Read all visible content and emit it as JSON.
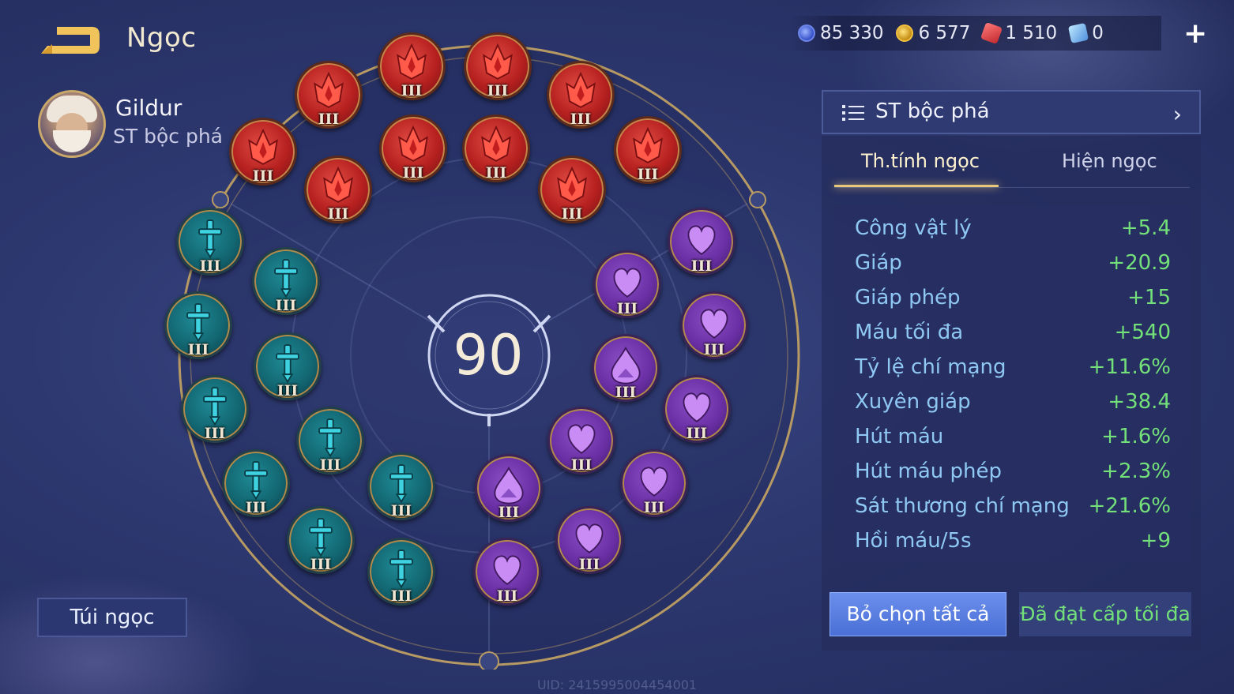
{
  "header": {
    "title": "Ngọc",
    "currencies": [
      {
        "icon": "blue-coin-icon",
        "value": "85 330"
      },
      {
        "icon": "gold-coin-icon",
        "value": "6 577"
      },
      {
        "icon": "red-gem-icon",
        "value": "1 510"
      },
      {
        "icon": "voucher-icon",
        "value": "0"
      }
    ],
    "plus_label": "+"
  },
  "hero": {
    "name": "Gildur",
    "preset": "ST bộc phá"
  },
  "ring": {
    "level": "90",
    "gems": [
      {
        "color": "red",
        "icon": "red-flame-gem-icon",
        "tier": "III"
      },
      {
        "color": "red",
        "icon": "red-flame-gem-icon",
        "tier": "III"
      },
      {
        "color": "red",
        "icon": "red-flame-gem-icon",
        "tier": "III"
      },
      {
        "color": "red",
        "icon": "red-flame-gem-icon",
        "tier": "III"
      },
      {
        "color": "red",
        "icon": "red-flame-gem-icon",
        "tier": "III"
      },
      {
        "color": "red",
        "icon": "red-flame-gem-icon",
        "tier": "III"
      },
      {
        "color": "red",
        "icon": "red-flame-gem-icon",
        "tier": "III"
      },
      {
        "color": "red",
        "icon": "red-flame-gem-icon",
        "tier": "III"
      },
      {
        "color": "red",
        "icon": "red-flame-gem-icon",
        "tier": "III"
      },
      {
        "color": "red",
        "icon": "red-flame-gem-icon",
        "tier": "III"
      },
      {
        "color": "teal",
        "icon": "teal-sword-gem-icon",
        "tier": "III"
      },
      {
        "color": "teal",
        "icon": "teal-sword-gem-icon",
        "tier": "III"
      },
      {
        "color": "teal",
        "icon": "teal-sword-gem-icon",
        "tier": "III"
      },
      {
        "color": "teal",
        "icon": "teal-sword-gem-icon",
        "tier": "III"
      },
      {
        "color": "teal",
        "icon": "teal-sword-gem-icon",
        "tier": "III"
      },
      {
        "color": "teal",
        "icon": "teal-sword-gem-icon",
        "tier": "III"
      },
      {
        "color": "teal",
        "icon": "teal-sword-gem-icon",
        "tier": "III"
      },
      {
        "color": "teal",
        "icon": "teal-sword-gem-icon",
        "tier": "III"
      },
      {
        "color": "teal",
        "icon": "teal-sword-gem-icon",
        "tier": "III"
      },
      {
        "color": "teal",
        "icon": "teal-sword-gem-icon",
        "tier": "III"
      },
      {
        "color": "purple",
        "icon": "purple-heart-gem-icon",
        "tier": "III"
      },
      {
        "color": "purple",
        "icon": "purple-heart-gem-icon",
        "tier": "III"
      },
      {
        "color": "purple",
        "icon": "purple-heart-gem-icon",
        "tier": "III"
      },
      {
        "color": "purple",
        "icon": "purple-drop-gem-icon",
        "tier": "III"
      },
      {
        "color": "purple",
        "icon": "purple-heart-gem-icon",
        "tier": "III"
      },
      {
        "color": "purple",
        "icon": "purple-heart-gem-icon",
        "tier": "III"
      },
      {
        "color": "purple",
        "icon": "purple-drop-gem-icon",
        "tier": "III"
      },
      {
        "color": "purple",
        "icon": "purple-heart-gem-icon",
        "tier": "III"
      },
      {
        "color": "purple",
        "icon": "purple-heart-gem-icon",
        "tier": "III"
      },
      {
        "color": "purple",
        "icon": "purple-heart-gem-icon",
        "tier": "III"
      }
    ]
  },
  "panel": {
    "preset_name": "ST bộc phá",
    "tabs": [
      {
        "label": "Th.tính ngọc",
        "active": true
      },
      {
        "label": "Hiện ngọc",
        "active": false
      }
    ],
    "stats": [
      {
        "label": "Công vật lý",
        "value": "+5.4"
      },
      {
        "label": "Giáp",
        "value": "+20.9"
      },
      {
        "label": "Giáp phép",
        "value": "+15"
      },
      {
        "label": "Máu tối đa",
        "value": "+540"
      },
      {
        "label": "Tỷ lệ chí mạng",
        "value": "+11.6%"
      },
      {
        "label": "Xuyên giáp",
        "value": "+38.4"
      },
      {
        "label": "Hút máu",
        "value": "+1.6%"
      },
      {
        "label": "Hút máu phép",
        "value": "+2.3%"
      },
      {
        "label": "Sát thương chí mạng",
        "value": "+21.6%"
      },
      {
        "label": "Hồi máu/5s",
        "value": "+9"
      }
    ],
    "deselect_label": "Bỏ chọn tất cả",
    "maxed_label": "Đã đạt cấp tối đa"
  },
  "gem_bag_label": "Túi ngọc",
  "uid": "UID: 2415995004454001",
  "colors": {
    "accent_gold": "#e8c77c",
    "stat_label": "#8fc8f2",
    "stat_value": "#73e07a",
    "button_blue": "#5a7fe0"
  }
}
